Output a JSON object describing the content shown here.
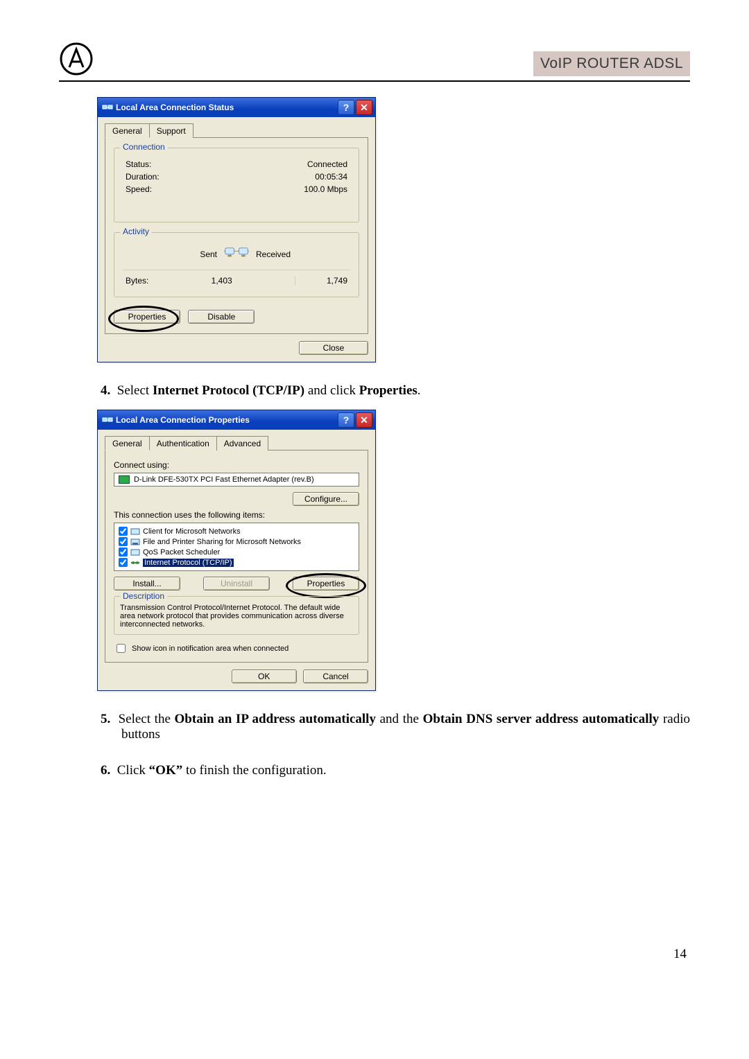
{
  "header": {
    "product": "VoIP ROUTER ADSL"
  },
  "dialog1": {
    "title": "Local Area Connection Status",
    "tabs": [
      "General",
      "Support"
    ],
    "connection": {
      "legend": "Connection",
      "status_label": "Status:",
      "status_value": "Connected",
      "duration_label": "Duration:",
      "duration_value": "00:05:34",
      "speed_label": "Speed:",
      "speed_value": "100.0 Mbps"
    },
    "activity": {
      "legend": "Activity",
      "sent_label": "Sent",
      "received_label": "Received",
      "bytes_label": "Bytes:",
      "sent_bytes": "1,403",
      "received_bytes": "1,749"
    },
    "buttons": {
      "properties": "Properties",
      "disable": "Disable",
      "close": "Close"
    }
  },
  "step4": {
    "num": "4.",
    "before": "Select ",
    "bold1": "Internet Protocol (TCP/IP)",
    "mid": " and click ",
    "bold2": "Properties",
    "after": "."
  },
  "dialog2": {
    "title": "Local Area Connection Properties",
    "tabs": [
      "General",
      "Authentication",
      "Advanced"
    ],
    "connect_using_label": "Connect using:",
    "adapter": "D-Link DFE-530TX PCI Fast Ethernet Adapter (rev.B)",
    "configure_btn": "Configure...",
    "items_label": "This connection uses the following items:",
    "items": [
      "Client for Microsoft Networks",
      "File and Printer Sharing for Microsoft Networks",
      "QoS Packet Scheduler",
      "Internet Protocol (TCP/IP)"
    ],
    "install_btn": "Install...",
    "uninstall_btn": "Uninstall",
    "properties_btn": "Properties",
    "desc_legend": "Description",
    "desc_text": "Transmission Control Protocol/Internet Protocol. The default wide area network protocol that provides communication across diverse interconnected networks.",
    "show_icon": "Show icon in notification area when connected",
    "ok": "OK",
    "cancel": "Cancel"
  },
  "step5": {
    "num": "5.",
    "t1": "Select the ",
    "b1": "Obtain an IP address automatically",
    "t2": " and the ",
    "b2": "Obtain DNS server address automatically",
    "t3": " radio buttons"
  },
  "step6": {
    "num": "6.",
    "t1": "Click ",
    "b1": "“OK”",
    "t2": " to finish the configuration."
  },
  "page_number": "14"
}
